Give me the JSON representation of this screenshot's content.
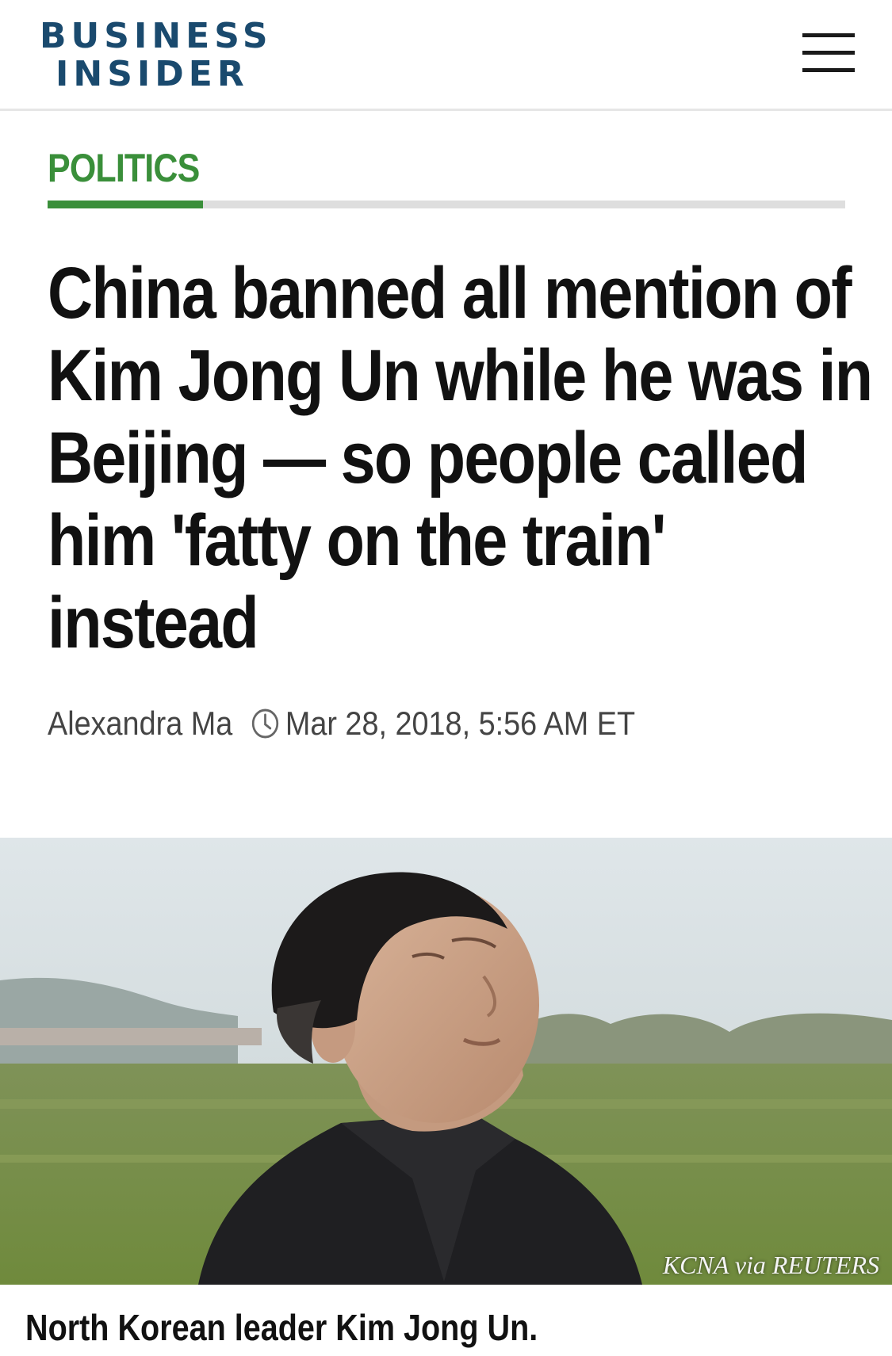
{
  "header": {
    "logo_line1": "BUSINESS",
    "logo_line2": "INSIDER",
    "menu_icon": "hamburger-menu-icon"
  },
  "section": {
    "label": "POLITICS",
    "accent_color": "#3a8f3a"
  },
  "article": {
    "headline_lines": [
      "China banned all mention of",
      "Kim Jong Un while he was in",
      "Beijing — so people called",
      "him 'fatty on the train'",
      "instead"
    ],
    "author": "Alexandra Ma",
    "timestamp": "Mar 28, 2018, 5:56 AM ET",
    "timestamp_icon": "clock-icon"
  },
  "photo": {
    "credit": "KCNA via REUTERS",
    "caption": "North Korean leader Kim Jong Un."
  },
  "colors": {
    "brand": "#1a4a6e",
    "section_green": "#3a8f3a",
    "text": "#111111"
  }
}
